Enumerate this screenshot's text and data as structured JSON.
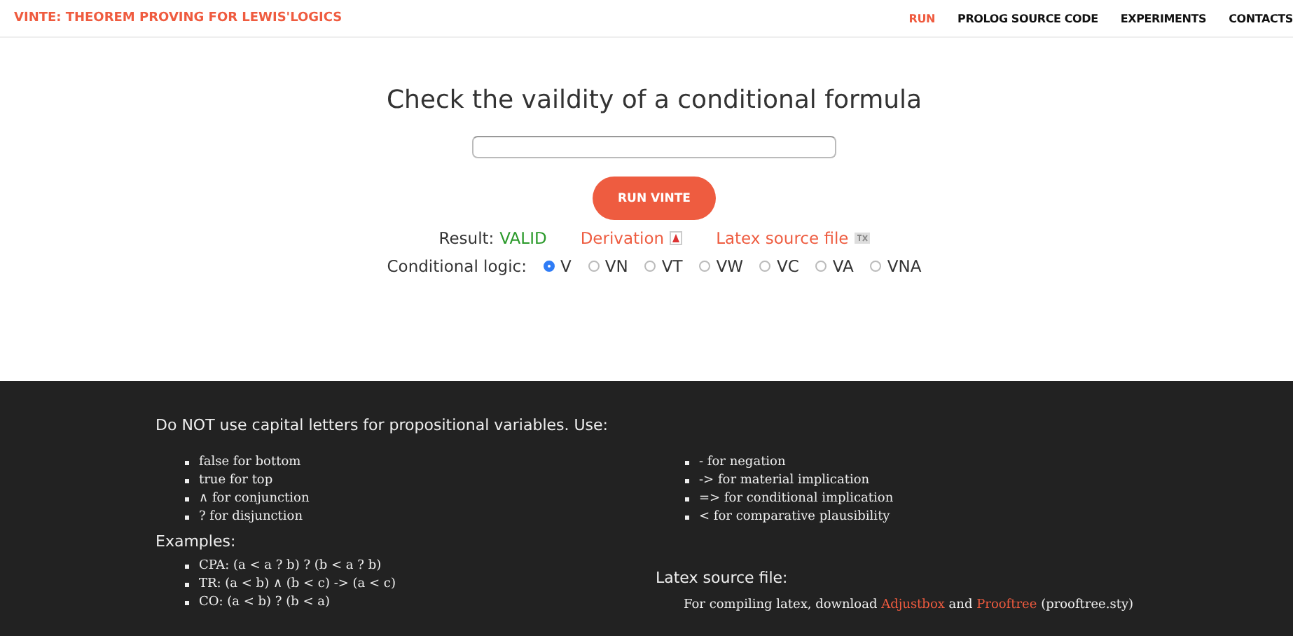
{
  "nav": {
    "brand": "VINTE: THEOREM PROVING FOR LEWIS'LOGICS",
    "links": [
      {
        "label": "RUN",
        "selected": true
      },
      {
        "label": "PROLOG SOURCE CODE",
        "selected": false
      },
      {
        "label": "EXPERIMENTS",
        "selected": false
      },
      {
        "label": "CONTACTS",
        "selected": false
      }
    ]
  },
  "main": {
    "title": "Check the vaildity of a conditional formula",
    "button": "RUN VINTE",
    "result_label": "Result:",
    "result_value": "VALID",
    "derivation_link": "Derivation",
    "latex_link": "Latex source file",
    "logic_label": "Conditional logic:",
    "logics": [
      {
        "label": "V",
        "selected": true
      },
      {
        "label": "VN",
        "selected": false
      },
      {
        "label": "VT",
        "selected": false
      },
      {
        "label": "VW",
        "selected": false
      },
      {
        "label": "VC",
        "selected": false
      },
      {
        "label": "VA",
        "selected": false
      },
      {
        "label": "VNA",
        "selected": false
      }
    ]
  },
  "footer": {
    "intro": "Do NOT use capital letters for propositional variables. Use:",
    "symbols_left": [
      "false for bottom",
      "true for top",
      "∧ for conjunction",
      "? for disjunction"
    ],
    "symbols_right": [
      "- for negation",
      "-> for material implication",
      "=> for conditional implication",
      "< for comparative plausibility"
    ],
    "examples_heading": "Examples:",
    "examples": [
      "CPA: (a < a ? b) ? (b < a ? b)",
      "TR: (a < b) ∧ (b < c) -> (a < c)",
      "CO: (a < b) ? (b < a)"
    ],
    "latex_heading": "Latex source file:",
    "latex_note": {
      "prefix": "For compiling latex, download ",
      "links": [
        "Adjustbox",
        "Prooftree"
      ],
      "joiner": " and ",
      "suffix": " (prooftree.sty)"
    }
  }
}
